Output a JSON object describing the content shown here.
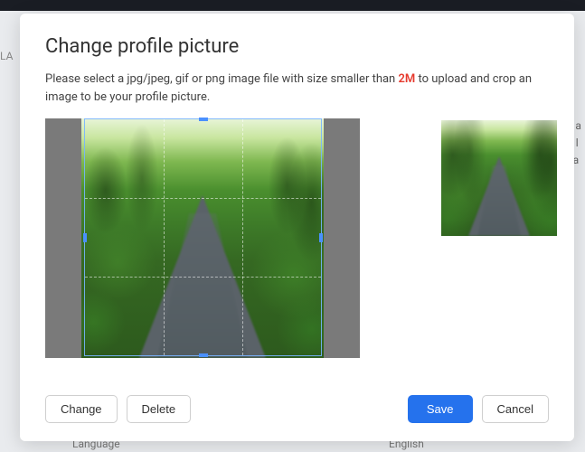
{
  "modal": {
    "title": "Change profile picture",
    "description_prefix": "Please select a jpg/jpeg, gif or png image file with size smaller than ",
    "size_limit": "2M",
    "description_suffix": " to upload and crop an image to be your profile picture."
  },
  "buttons": {
    "change": "Change",
    "delete": "Delete",
    "save": "Save",
    "cancel": "Cancel"
  },
  "background": {
    "left_fragment": "LA",
    "right_fragment_1": "e a",
    "right_fragment_2": "d l",
    "right_fragment_3": "ha",
    "bottom_label_1": "Language",
    "bottom_label_2": "English"
  },
  "cropper": {
    "image_alt": "forest-path-image",
    "preview_alt": "profile-preview"
  }
}
